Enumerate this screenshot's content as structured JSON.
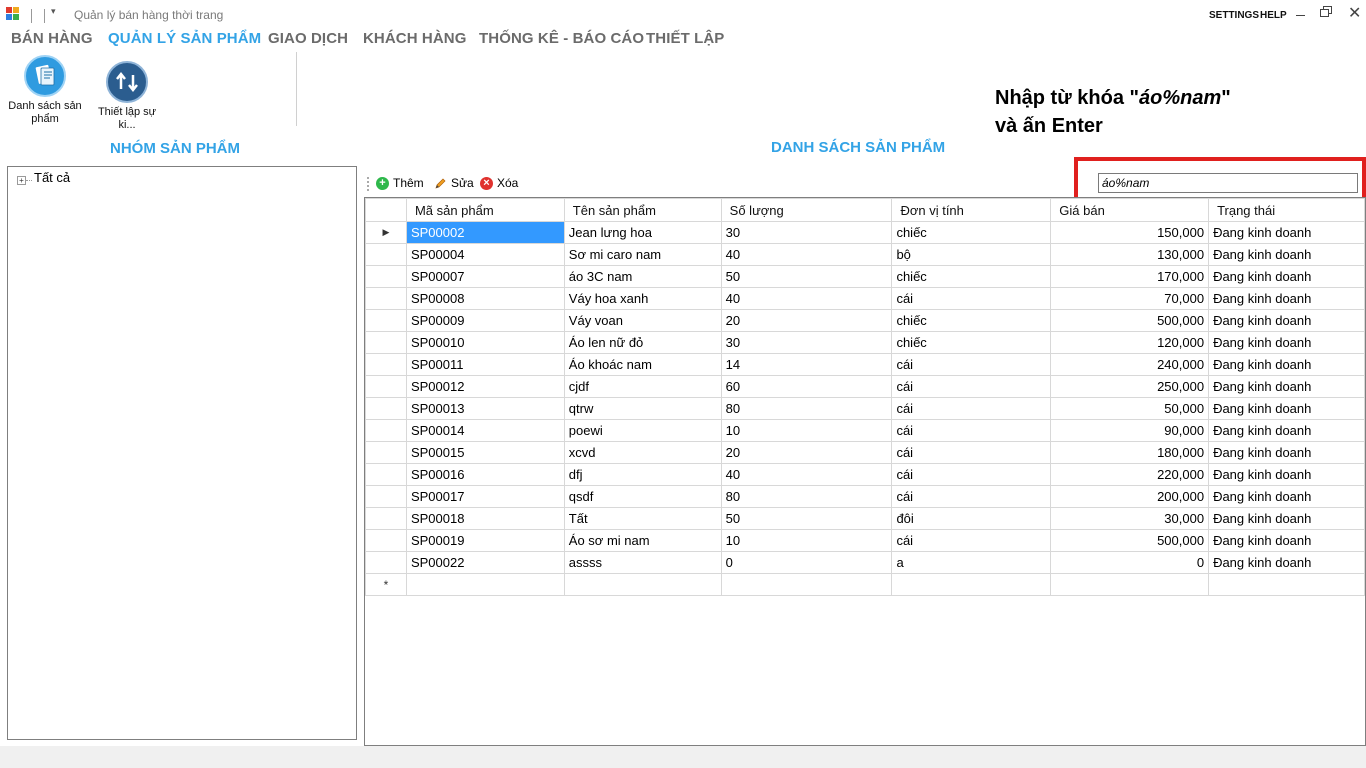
{
  "window": {
    "title": "Quản lý bán hàng thời trang",
    "settings": "SETTINGS",
    "help": "HELP",
    "close_glyph": "✕"
  },
  "menu": [
    {
      "label": "BÁN HÀNG",
      "active": false
    },
    {
      "label": "QUẢN LÝ SẢN PHẨM",
      "active": true
    },
    {
      "label": "GIAO DỊCH",
      "active": false
    },
    {
      "label": "KHÁCH HÀNG",
      "active": false
    },
    {
      "label": "THỐNG KÊ - BÁO CÁO",
      "active": false
    },
    {
      "label": "THIẾT LẬP",
      "active": false
    }
  ],
  "ribbon": {
    "product_list": {
      "label": "Danh sách sản phẩm",
      "icon": "document-list-icon"
    },
    "setup": {
      "label": "Thiết lập sự ki...",
      "icon": "transfer-arrows-icon"
    }
  },
  "annotation": {
    "prefix": "Nhập từ khóa \"",
    "keyword": "áo%nam",
    "suffix": "\"",
    "line2": "và ấn Enter"
  },
  "left_panel": {
    "heading": "NHÓM SẢN PHẨM",
    "tree_root": "Tất cả",
    "expander": "+"
  },
  "main": {
    "heading": "DANH SÁCH SẢN PHẨM",
    "toolbar": {
      "add": "Thêm",
      "edit": "Sửa",
      "delete": "Xóa"
    },
    "search": {
      "value": "áo%nam"
    }
  },
  "grid": {
    "columns": [
      "Mã sản phẩm",
      "Tên sản phẩm",
      "Số lượng",
      "Đơn vị tính",
      "Giá bán",
      "Trạng thái"
    ],
    "rows": [
      [
        "SP00002",
        "Jean lưng hoa",
        "30",
        "chiếc",
        "150,000",
        "Đang kinh doanh"
      ],
      [
        "SP00004",
        "Sơ mi caro nam",
        "40",
        "bộ",
        "130,000",
        "Đang kinh doanh"
      ],
      [
        "SP00007",
        "áo 3C nam",
        "50",
        "chiếc",
        "170,000",
        "Đang kinh doanh"
      ],
      [
        "SP00008",
        "Váy hoa xanh",
        "40",
        "cái",
        "70,000",
        "Đang kinh doanh"
      ],
      [
        "SP00009",
        "Váy voan",
        "20",
        "chiếc",
        "500,000",
        "Đang kinh doanh"
      ],
      [
        "SP00010",
        "Áo len nữ đỏ",
        "30",
        "chiếc",
        "120,000",
        "Đang kinh doanh"
      ],
      [
        "SP00011",
        "Áo khoác nam",
        "14",
        "cái",
        "240,000",
        "Đang kinh doanh"
      ],
      [
        "SP00012",
        "cjdf",
        "60",
        "cái",
        "250,000",
        "Đang kinh doanh"
      ],
      [
        "SP00013",
        "qtrw",
        "80",
        "cái",
        "50,000",
        "Đang kinh doanh"
      ],
      [
        "SP00014",
        "poewi",
        "10",
        "cái",
        "90,000",
        "Đang kinh doanh"
      ],
      [
        "SP00015",
        "xcvd",
        "20",
        "cái",
        "180,000",
        "Đang kinh doanh"
      ],
      [
        "SP00016",
        "dfj",
        "40",
        "cái",
        "220,000",
        "Đang kinh doanh"
      ],
      [
        "SP00017",
        "qsdf",
        "80",
        "cái",
        "200,000",
        "Đang kinh doanh"
      ],
      [
        "SP00018",
        "Tất",
        "50",
        "đôi",
        "30,000",
        "Đang kinh doanh"
      ],
      [
        "SP00019",
        "Áo sơ mi nam",
        "10",
        "cái",
        "500,000",
        "Đang kinh doanh"
      ],
      [
        "SP00022",
        "assss",
        "0",
        "a",
        "0",
        "Đang kinh doanh"
      ]
    ],
    "current_row_marker": "▶",
    "new_row_marker": "*"
  }
}
